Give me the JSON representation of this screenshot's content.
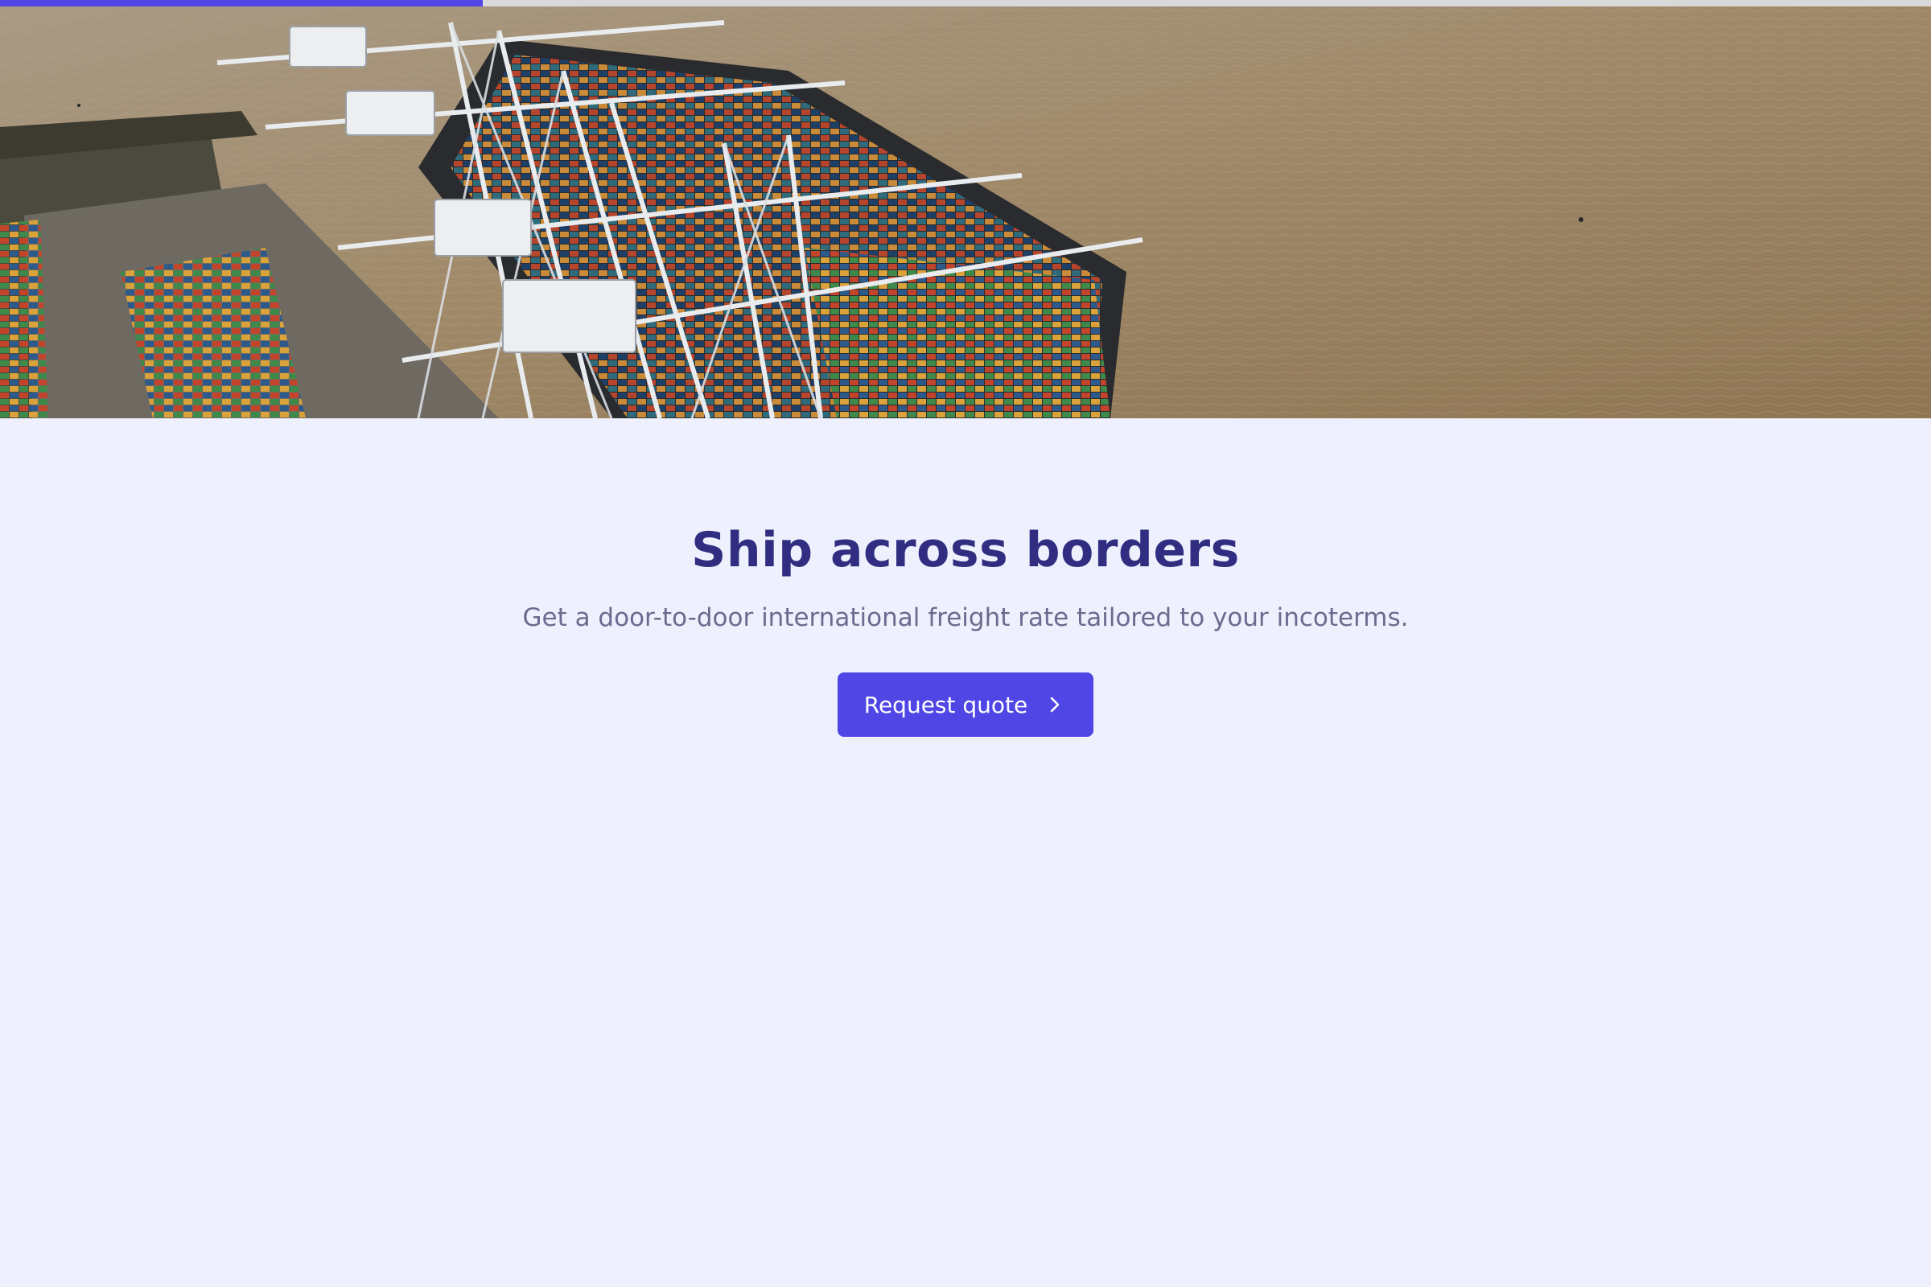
{
  "page": {
    "scroll_progress_percent": 25
  },
  "hero": {
    "image": "aerial-container-port-photo"
  },
  "main": {
    "headline": "Ship across borders",
    "subheadline": "Get a door-to-door international freight rate tailored to your incoterms.",
    "cta_label": "Request quote",
    "cta_icon": "chevron-right-icon"
  },
  "colors": {
    "accent": "#4f46e5",
    "headline": "#312e81",
    "subtext": "#6b6b8f",
    "background": "#eef1fd"
  }
}
